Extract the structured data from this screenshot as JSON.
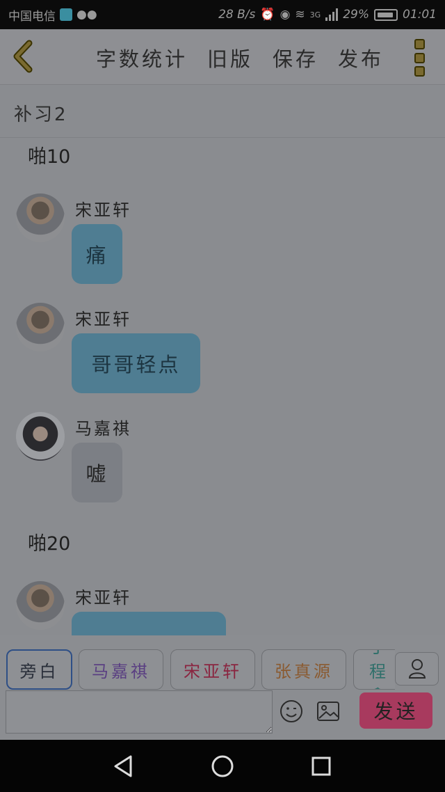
{
  "status_bar": {
    "carrier": "中国电信",
    "speed": "28 B/s",
    "network": "3G",
    "battery": "29%",
    "time": "01:01"
  },
  "app_bar": {
    "actions": [
      "字数统计",
      "旧版",
      "保存",
      "发布"
    ]
  },
  "story_title": "补习2",
  "chat": {
    "narration_1": "啪10",
    "narration_2": "啪20",
    "messages": [
      {
        "sender": "宋亚轩",
        "text": "痛"
      },
      {
        "sender": "宋亚轩",
        "text": "哥哥轻点"
      },
      {
        "sender": "马嘉祺",
        "text": "嘘"
      },
      {
        "sender": "宋亚轩",
        "text": "……"
      }
    ]
  },
  "roles": [
    {
      "name": "旁白",
      "color": "#2a2f3a"
    },
    {
      "name": "马嘉祺",
      "color": "#5a3f82"
    },
    {
      "name": "宋亚轩",
      "color": "#8a2540"
    },
    {
      "name": "张真源",
      "color": "#8a5a30"
    },
    {
      "name": "丁程鑫",
      "color": "#2f6f6a"
    }
  ],
  "input": {
    "placeholder": "",
    "send_label": "发送"
  },
  "colors": {
    "bubble_blue": "#4f7d92",
    "send_button": "#a83a5e"
  }
}
